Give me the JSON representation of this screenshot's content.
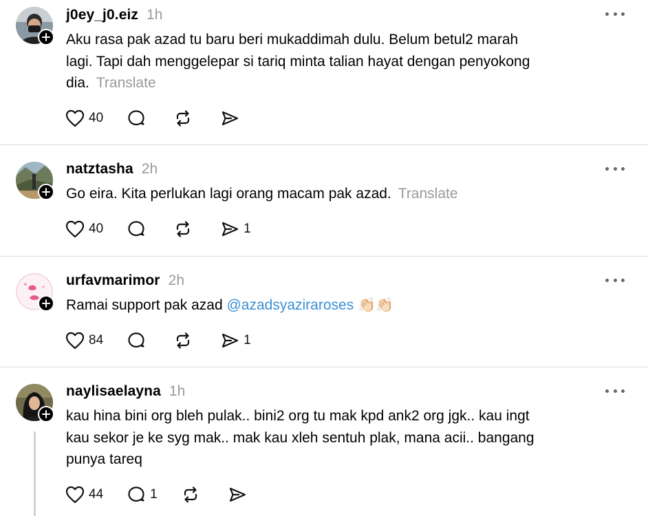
{
  "posts": [
    {
      "username": "j0ey_j0.eiz",
      "time": "1h",
      "lines": [
        "Aku rasa pak azad tu baru beri mukaddimah dulu. Belum betul2 marah",
        "lagi. Tapi dah menggelepar si tariq minta talian hayat dengan penyokong",
        "dia."
      ],
      "translate": "Translate",
      "likes": "40",
      "replies": "",
      "reposts": "",
      "shares": ""
    },
    {
      "username": "natztasha",
      "time": "2h",
      "text": "Go eira. Kita perlukan lagi orang macam pak azad.",
      "translate": "Translate",
      "likes": "40",
      "replies": "",
      "reposts": "",
      "shares": "1"
    },
    {
      "username": "urfavmarimor",
      "time": "2h",
      "text": "Ramai support pak azad ",
      "mention": "@azadsyaziraroses",
      "emoji": "👏🏻👏🏻",
      "likes": "84",
      "replies": "",
      "reposts": "",
      "shares": "1"
    },
    {
      "username": "naylisaelayna",
      "time": "1h",
      "lines": [
        "kau hina bini org bleh pulak.. bini2 org tu mak kpd ank2 org jgk.. kau ingt",
        "kau sekor je ke syg mak.. mak kau xleh sentuh plak, mana acii.. bangang",
        "punya tareq"
      ],
      "likes": "44",
      "replies": "1",
      "reposts": "",
      "shares": ""
    }
  ],
  "icons": {
    "like": "heart-icon",
    "reply": "comment-icon",
    "repost": "repost-icon",
    "share": "send-icon",
    "more": "more-dots-icon",
    "follow": "plus-icon"
  },
  "colors": {
    "text": "#000000",
    "muted": "#999999",
    "mention": "#3a8fd6",
    "divider": "#dbdbdb"
  }
}
